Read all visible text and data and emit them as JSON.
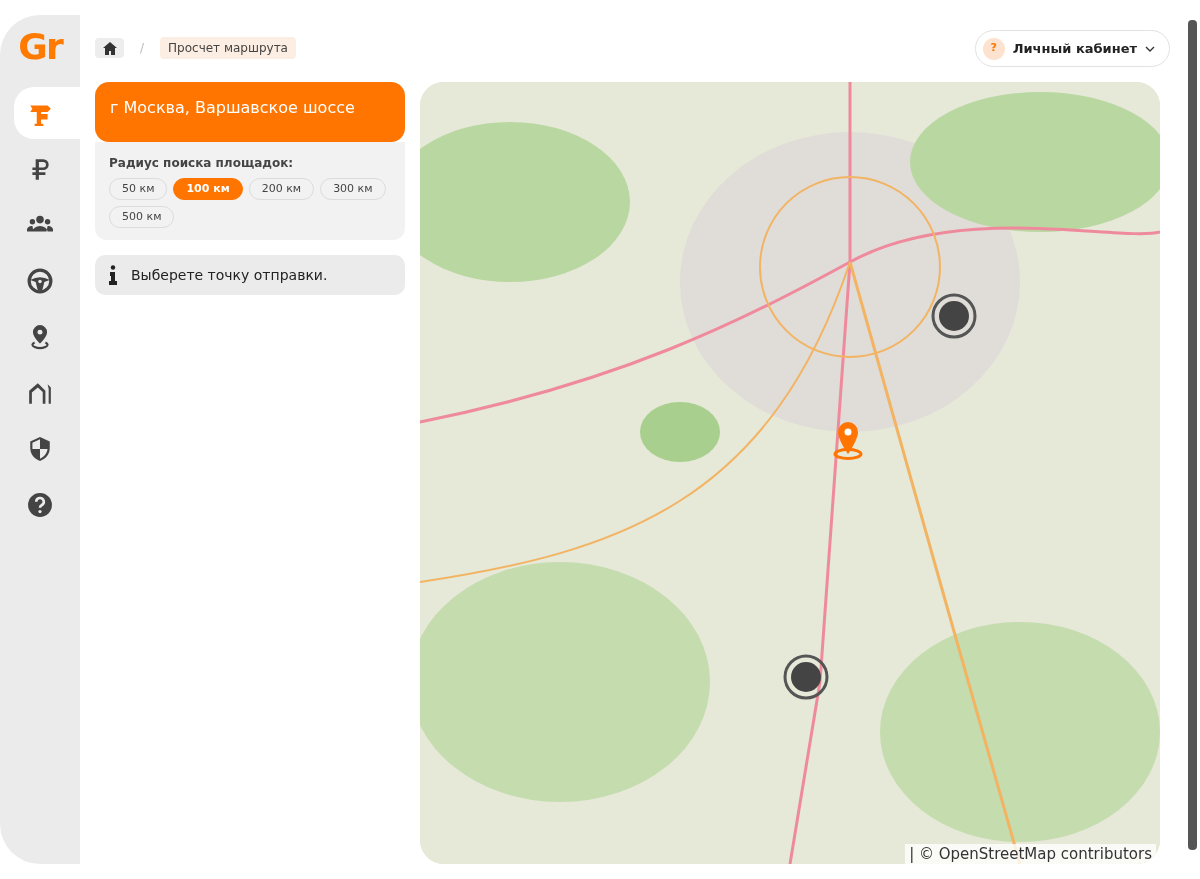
{
  "logo": "Gr",
  "nav": [
    {
      "selected": true
    },
    {
      "selected": false
    },
    {
      "selected": false
    },
    {
      "selected": false
    },
    {
      "selected": false
    },
    {
      "selected": false
    },
    {
      "selected": false
    },
    {
      "selected": false
    }
  ],
  "breadcrumb": {
    "current": "Просчет маршрута",
    "separator": "/"
  },
  "account": {
    "badge": "?",
    "label": "Личный кабинет"
  },
  "address": "г Москва, Варшавское шоссе",
  "radius": {
    "label": "Радиус поиска площадок:",
    "options": [
      {
        "label": "50 км",
        "selected": false
      },
      {
        "label": "100 км",
        "selected": true
      },
      {
        "label": "200 км",
        "selected": false
      },
      {
        "label": "300 км",
        "selected": false
      },
      {
        "label": "500 км",
        "selected": false
      }
    ]
  },
  "info": "Выберете точку отправки.",
  "map": {
    "attribution": "| © OpenStreetMap contributors"
  }
}
